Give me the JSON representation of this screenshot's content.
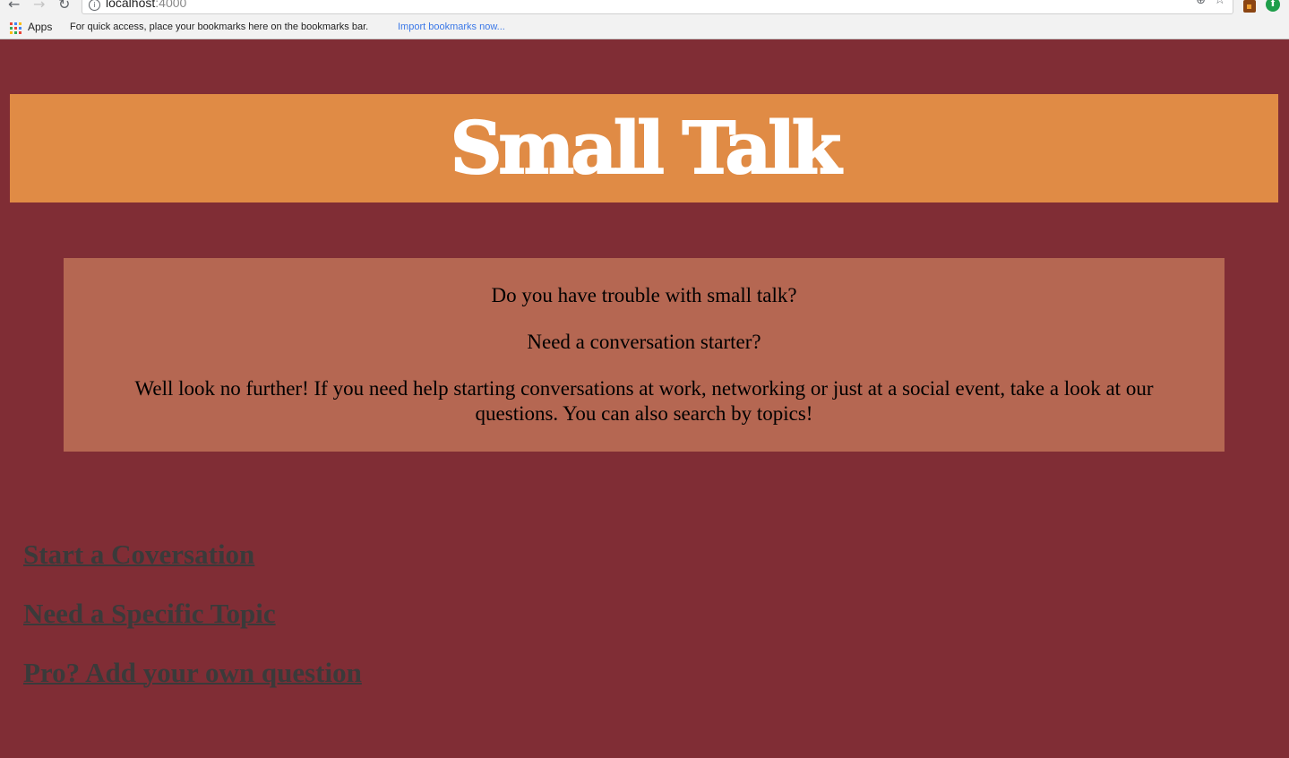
{
  "browser": {
    "url_host": "localhost",
    "url_port": ":4000",
    "bookmarks_bar": {
      "apps_label": "Apps",
      "info_text": "For quick access, place your bookmarks here on the bookmarks bar.",
      "import_link": "Import bookmarks now..."
    },
    "icons": [
      "back-arrow-icon",
      "forward-arrow-icon",
      "reload-icon",
      "info-icon",
      "zoom-icon",
      "star-icon",
      "apps-grid-icon"
    ]
  },
  "page": {
    "title": "Small Talk",
    "intro": {
      "question_1": "Do you have trouble with small talk?",
      "question_2": "Need a conversation starter?",
      "body": "Well look no further! If you need help starting conversations at work, networking or just at a social event, take a look at our questions. You can also search by topics!"
    },
    "links": {
      "start": "Start a Coversation",
      "topic": "Need a Specific Topic",
      "pro": "Pro? Add your own question"
    }
  },
  "colors": {
    "background": "#802d35",
    "header": "#e08b45",
    "intro_box": "#b56752",
    "title_text": "#ffffff",
    "link_text": "#3a3a3a"
  }
}
